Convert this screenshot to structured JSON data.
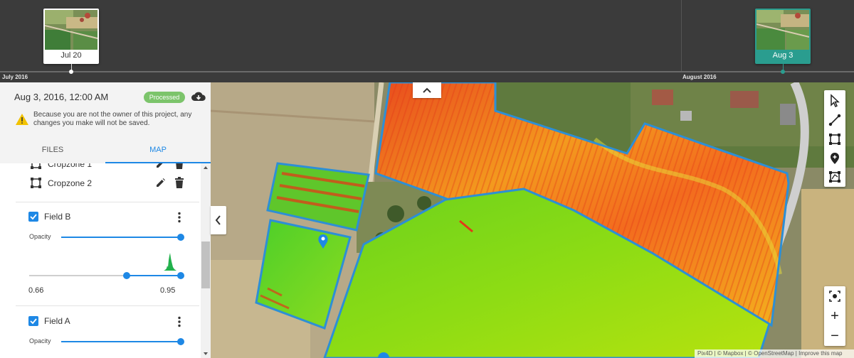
{
  "timeline": {
    "months": [
      "July 2016",
      "August 2016"
    ],
    "captures": [
      {
        "date": "Jul 20",
        "active": false
      },
      {
        "date": "Aug 3",
        "active": true
      }
    ]
  },
  "panel": {
    "capture_date": "Aug 3, 2016, 12:00 AM",
    "status": "Processed",
    "warning": "Because you are not the owner of this project, any changes you make will not be saved.",
    "tabs": [
      "FILES",
      "MAP"
    ],
    "active_tab": "MAP",
    "cropzones": [
      "Cropzone 1",
      "Cropzone 2"
    ],
    "fields": [
      {
        "name": "Field B",
        "checked": true,
        "opacity_label": "Opacity",
        "range_min": "0.66",
        "range_max": "0.95"
      },
      {
        "name": "Field A",
        "checked": true,
        "opacity_label": "Opacity"
      }
    ]
  },
  "map": {
    "attribution": [
      "Pix4D",
      "© Mapbox",
      "© OpenStreetMap",
      "Improve this map"
    ],
    "zoom_in": "+",
    "zoom_out": "−"
  },
  "colors": {
    "accent": "#1e88e5",
    "timeline_active": "#2a9d8f",
    "processed": "#7cc46b",
    "warning": "#f2c200"
  }
}
